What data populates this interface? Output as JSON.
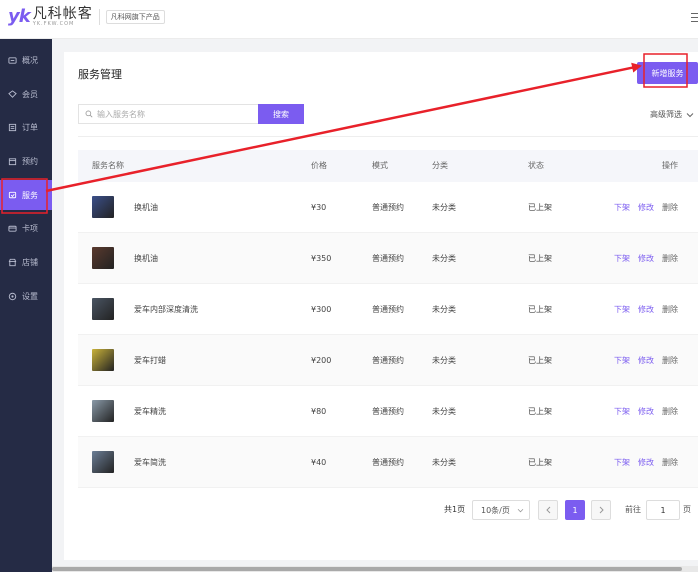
{
  "header": {
    "logo_mark": "yk",
    "logo_cn": "凡科帐客",
    "logo_en": "YK.FKW.COM",
    "tag": "凡科网旗下产品"
  },
  "sidebar": {
    "items": [
      {
        "label": "概况",
        "icon": "dashboard-icon"
      },
      {
        "label": "会员",
        "icon": "member-icon"
      },
      {
        "label": "订单",
        "icon": "order-icon"
      },
      {
        "label": "预约",
        "icon": "booking-icon"
      },
      {
        "label": "服务",
        "icon": "service-icon",
        "active": true
      },
      {
        "label": "卡项",
        "icon": "card-icon"
      },
      {
        "label": "店铺",
        "icon": "shop-icon"
      },
      {
        "label": "设置",
        "icon": "gear-icon"
      }
    ]
  },
  "main": {
    "title": "服务管理",
    "new_button": "新增服务",
    "search": {
      "placeholder": "输入服务名称",
      "value": "",
      "button": "搜索"
    },
    "advanced_filter": "高级筛选",
    "table": {
      "headers": [
        "服务名称",
        "价格",
        "模式",
        "分类",
        "状态",
        "操作"
      ],
      "rows": [
        {
          "name": "换机油",
          "price": "¥30",
          "mode": "普通预约",
          "category": "未分类",
          "status": "已上架",
          "thumb_color": "#3b4f8a"
        },
        {
          "name": "换机油",
          "price": "¥350",
          "mode": "普通预约",
          "category": "未分类",
          "status": "已上架",
          "thumb_color": "#5a3a2e"
        },
        {
          "name": "爱车内部深度清洗",
          "price": "¥300",
          "mode": "普通预约",
          "category": "未分类",
          "status": "已上架",
          "thumb_color": "#4a5563"
        },
        {
          "name": "爱车打蜡",
          "price": "¥200",
          "mode": "普通预约",
          "category": "未分类",
          "status": "已上架",
          "thumb_color": "#c9b23a"
        },
        {
          "name": "爱车精洗",
          "price": "¥80",
          "mode": "普通预约",
          "category": "未分类",
          "status": "已上架",
          "thumb_color": "#8a9aa8"
        },
        {
          "name": "爱车简洗",
          "price": "¥40",
          "mode": "普通预约",
          "category": "未分类",
          "status": "已上架",
          "thumb_color": "#6b7e96"
        }
      ],
      "actions": [
        "下架",
        "修改",
        "删除"
      ]
    },
    "pagination": {
      "total": "共1页",
      "page_size": "10条/页",
      "current_page": "1",
      "goto_label": "前往",
      "goto_value": "1",
      "page_suffix": "页"
    }
  },
  "colors": {
    "accent": "#7b5cf0",
    "sidebar_bg": "#252b45",
    "annotation": "#e8212a"
  }
}
